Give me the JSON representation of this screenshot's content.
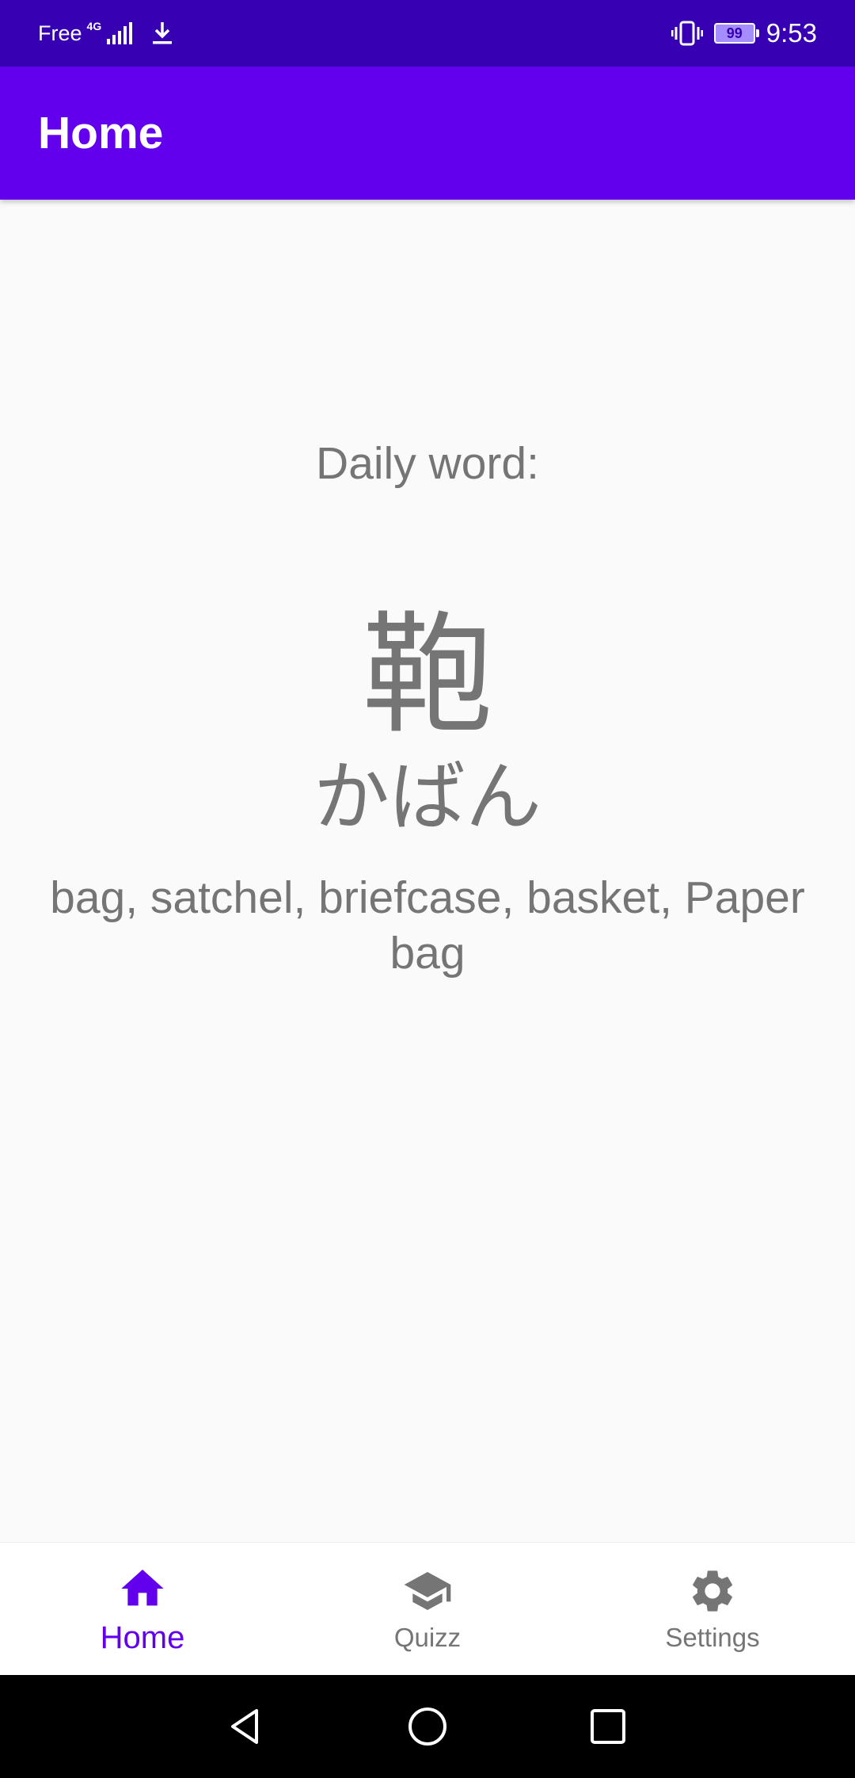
{
  "status_bar": {
    "carrier": "Free",
    "network_type": "4G",
    "battery_level": "99",
    "time": "9:53",
    "icons": [
      "signal-icon",
      "download-icon",
      "vibrate-icon",
      "battery-icon"
    ]
  },
  "app_bar": {
    "title": "Home"
  },
  "daily_word": {
    "label": "Daily word:",
    "kanji": "鞄",
    "reading": "かばん",
    "meaning": "bag, satchel, briefcase, basket, Paper bag"
  },
  "bottom_nav": {
    "items": [
      {
        "label": "Home",
        "icon": "home-icon",
        "active": true
      },
      {
        "label": "Quizz",
        "icon": "graduation-cap-icon",
        "active": false
      },
      {
        "label": "Settings",
        "icon": "gear-icon",
        "active": false
      }
    ]
  },
  "colors": {
    "status_bar": "#3700b3",
    "app_bar": "#6200ee",
    "active_nav": "#6200ee",
    "inactive_nav": "#757575",
    "text": "#757575",
    "background": "#fafafa"
  }
}
